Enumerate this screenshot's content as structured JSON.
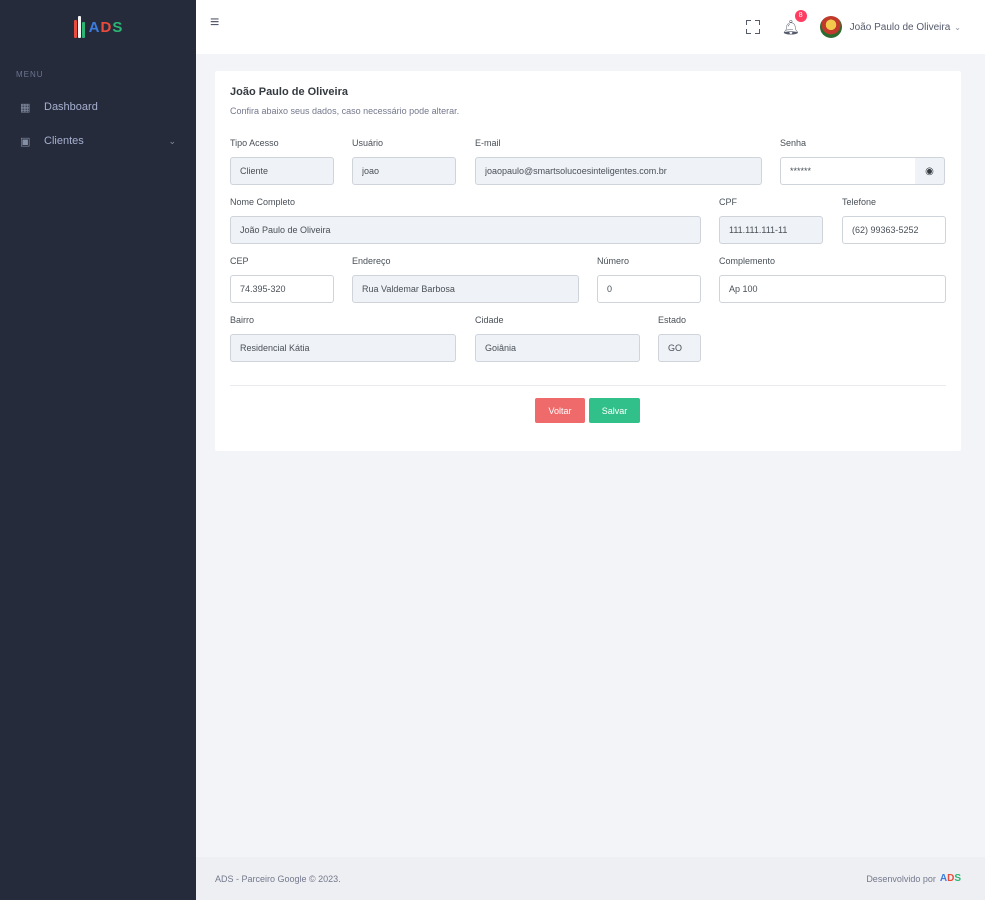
{
  "sidebar": {
    "logo_text": [
      "A",
      "D",
      "S"
    ],
    "menu_title": "MENU",
    "items": [
      {
        "label": "Dashboard",
        "icon": "dashboard-icon"
      },
      {
        "label": "Clientes",
        "icon": "clients-icon"
      }
    ]
  },
  "header": {
    "notification_count": "8",
    "user_name": "João Paulo de Oliveira"
  },
  "profile": {
    "title": "João Paulo de Oliveira",
    "subtitle": "Confira abaixo seus dados, caso necessário pode alterar.",
    "fields": {
      "tipo_acesso": {
        "label": "Tipo Acesso",
        "value": "Cliente"
      },
      "usuario": {
        "label": "Usuário",
        "value": "joao"
      },
      "email": {
        "label": "E-mail",
        "value": "joaopaulo@smartsolucoesinteligentes.com.br"
      },
      "senha": {
        "label": "Senha",
        "value": "******"
      },
      "nome": {
        "label": "Nome Completo",
        "value": "João Paulo de Oliveira"
      },
      "cpf": {
        "label": "CPF",
        "value": "111.111.111-11"
      },
      "telefone": {
        "label": "Telefone",
        "value": "(62) 99363-5252"
      },
      "cep": {
        "label": "CEP",
        "value": "74.395-320"
      },
      "endereco": {
        "label": "Endereço",
        "value": "Rua Valdemar Barbosa"
      },
      "numero": {
        "label": "Número",
        "value": "0"
      },
      "complemento": {
        "label": "Complemento",
        "value": "Ap 100"
      },
      "bairro": {
        "label": "Bairro",
        "value": "Residencial Kátia"
      },
      "cidade": {
        "label": "Cidade",
        "value": "Goiânia"
      },
      "estado": {
        "label": "Estado",
        "value": "GO"
      }
    },
    "buttons": {
      "back": "Voltar",
      "save": "Salvar"
    }
  },
  "footer": {
    "left": "ADS - Parceiro Google © 2023.",
    "right": "Desenvolvido por"
  },
  "colors": {
    "sidebar_bg": "#252b3b",
    "logo_blue": "#3b7ddd",
    "logo_red": "#e94b3c",
    "logo_green": "#2bb673",
    "back_button": "#ef6b6b",
    "save_button": "#31c08a"
  }
}
